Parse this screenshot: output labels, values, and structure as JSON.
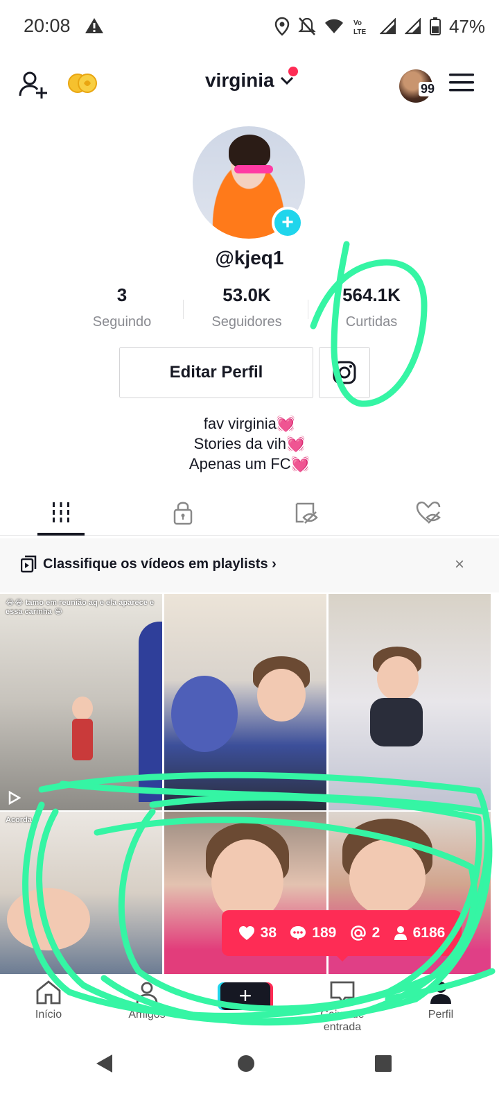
{
  "status_bar": {
    "time": "20:08",
    "battery": "47%",
    "icons": [
      "alert-icon",
      "location-icon",
      "mute-icon",
      "wifi-icon",
      "volte-icon",
      "signal-icon",
      "signal-icon",
      "battery-icon"
    ]
  },
  "header": {
    "username": "virginia",
    "avatar_badge": "99",
    "icons": [
      "add-user-icon",
      "coins-icon",
      "chevron-down-icon",
      "menu-icon"
    ]
  },
  "profile": {
    "handle": "@kjeq1",
    "stats": [
      {
        "value": "3",
        "label": "Seguindo"
      },
      {
        "value": "53.0K",
        "label": "Seguidores"
      },
      {
        "value": "564.1K",
        "label": "Curtidas"
      }
    ],
    "edit_button": "Editar Perfil",
    "bio": [
      "fav virginia",
      "Stories da vih",
      "Apenas um FC"
    ],
    "bio_emoji": "💓"
  },
  "tabs": [
    "grid-icon",
    "lock-icon",
    "eye-off-icon",
    "heart-eye-off-icon"
  ],
  "playlist_banner": {
    "text": "Classifique os vídeos em playlists",
    "chevron": "›",
    "close": "×"
  },
  "videos": [
    {
      "caption": "😂😂 tamo em reunião aq e ela aparece e essa carinha 😂"
    },
    {
      "caption": ""
    },
    {
      "caption": ""
    },
    {
      "caption": "Acorda"
    },
    {
      "caption": ""
    },
    {
      "caption": ""
    }
  ],
  "tooltip": {
    "likes": "38",
    "comments": "189",
    "mentions": "2",
    "followers": "6186"
  },
  "bottom_nav": [
    {
      "label": "Início"
    },
    {
      "label": "Amigos"
    },
    {
      "label": ""
    },
    {
      "label": "Caixa de entrada"
    },
    {
      "label": "Perfil"
    }
  ],
  "colors": {
    "accent_red": "#fe2c55",
    "accent_cyan": "#20d5ec",
    "scribble_green": "#35f5a4"
  }
}
